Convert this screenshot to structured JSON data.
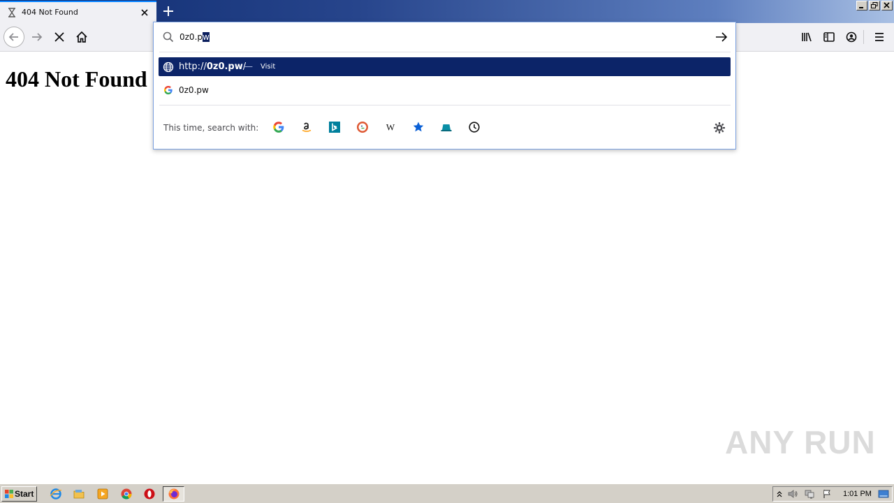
{
  "tab": {
    "title": "404 Not Found"
  },
  "page": {
    "heading": "404 Not Found"
  },
  "urlbar": {
    "typed": "0z0.p",
    "selected": "w"
  },
  "results": {
    "visit": {
      "prefix": "http://",
      "host": "0z0.pw",
      "suffix": "/",
      "dash": "—",
      "action": "Visit"
    },
    "search": {
      "text": "0z0.pw"
    }
  },
  "oneoff": {
    "label": "This time, search with:",
    "engines": [
      "google-icon",
      "amazon-icon",
      "bing-icon",
      "duckduckgo-icon",
      "wikipedia-icon",
      "bookmarks-icon",
      "tabs-icon",
      "history-icon"
    ]
  },
  "watermark": {
    "text": "ANY RUN"
  },
  "taskbar": {
    "start_label": "Start",
    "clock": "1:01 PM"
  },
  "colors": {
    "accent": "#0a84ff",
    "selection": "#0c2468",
    "titlebar": "#0d2a6e"
  }
}
